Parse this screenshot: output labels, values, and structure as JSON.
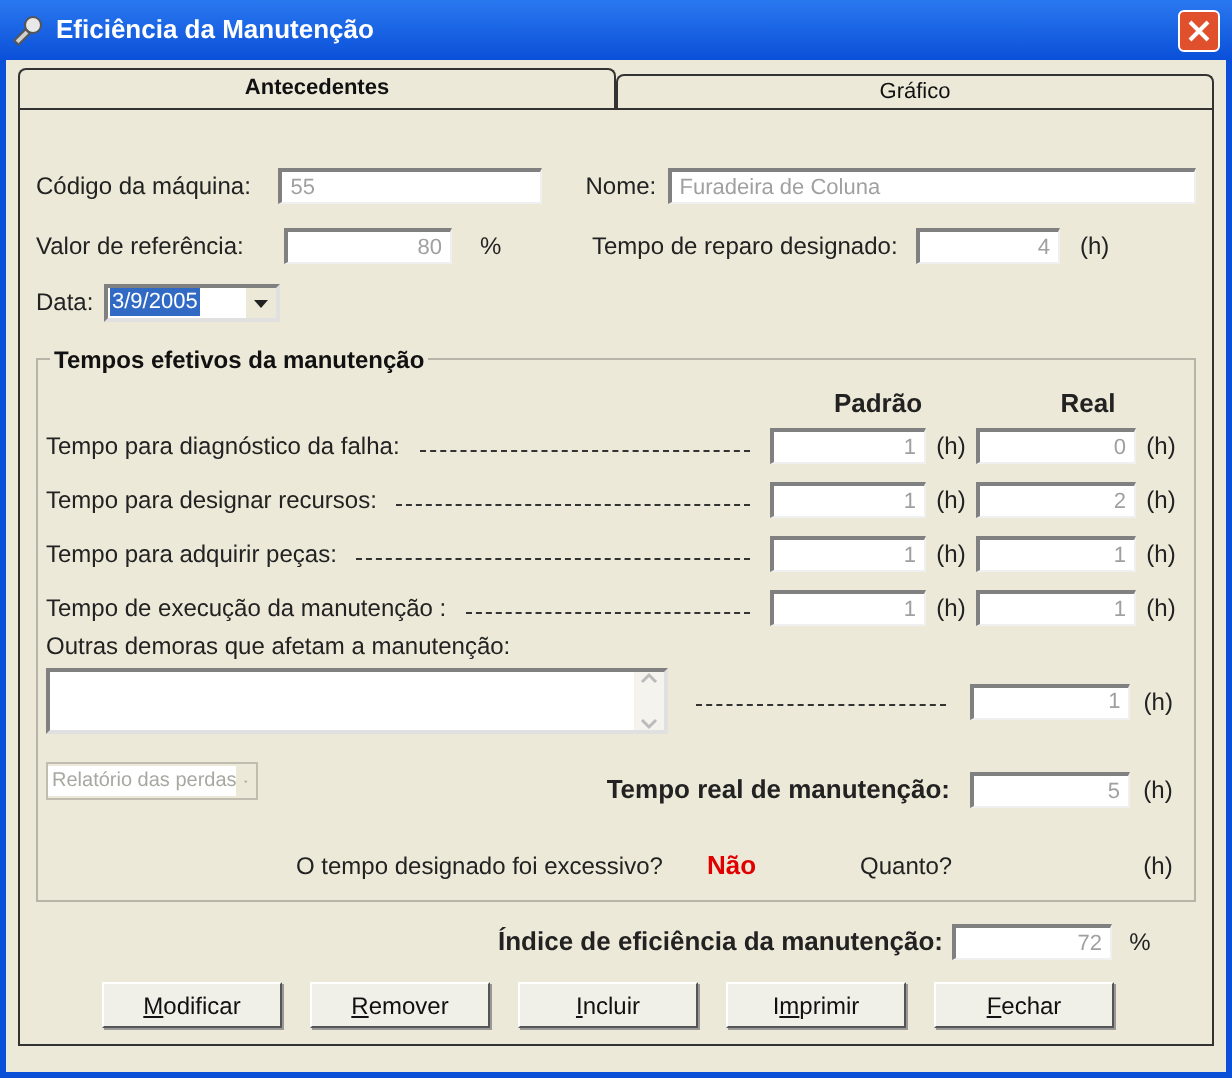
{
  "window": {
    "title": "Eficiência da Manutenção"
  },
  "tabs": [
    {
      "label": "Antecedentes",
      "selected": true
    },
    {
      "label": "Gráfico",
      "selected": false
    }
  ],
  "machine": {
    "code_label": "Código da máquina:",
    "code": "55",
    "name_label": "Nome:",
    "name": "Furadeira de Coluna"
  },
  "reference": {
    "label": "Valor de referência:",
    "value": "80",
    "unit": "%"
  },
  "repair_time": {
    "label": "Tempo de reparo designado:",
    "value": "4",
    "unit": "(h)"
  },
  "date": {
    "label": "Data:",
    "value": "3/9/2005"
  },
  "group": {
    "title": "Tempos efetivos da manutenção",
    "headings": [
      "Padrão",
      "Real"
    ],
    "rows": [
      {
        "label": "Tempo para diagnóstico da falha:",
        "standard": "1",
        "standard_unit": "(h)",
        "real": "0",
        "real_unit": "(h)"
      },
      {
        "label": "Tempo para designar recursos:",
        "standard": "1",
        "standard_unit": "(h)",
        "real": "2",
        "real_unit": "(h)"
      },
      {
        "label": "Tempo para adquirir peças:",
        "standard": "1",
        "standard_unit": "(h)",
        "real": "1",
        "real_unit": "(h)"
      },
      {
        "label": "Tempo de execução da manutenção :",
        "standard": "1",
        "standard_unit": "(h)",
        "real": "1",
        "real_unit": "(h)"
      }
    ],
    "other": {
      "label": "Outras demoras que afetam a manutenção:",
      "real": "1",
      "unit": "(h)"
    },
    "report": {
      "value": "Relatório das perdas",
      "disabled": true
    },
    "real_total": {
      "label": "Tempo real de manutenção:",
      "value": "5",
      "unit": "(h)"
    },
    "question": {
      "label": "O tempo designado foi excessivo?",
      "answer": "Não",
      "how_much": "Quanto?",
      "unit": "(h)"
    }
  },
  "efficiency": {
    "label": "Índice de eficiência da manutenção:",
    "value": "72",
    "unit": "%"
  },
  "buttons": [
    {
      "key": "M",
      "after": "odificar"
    },
    {
      "key": "R",
      "after": "emover"
    },
    {
      "key": "I",
      "after": "ncluir"
    },
    {
      "before": "I",
      "key": "m",
      "after": "primir"
    },
    {
      "key": "F",
      "after": "echar"
    }
  ]
}
